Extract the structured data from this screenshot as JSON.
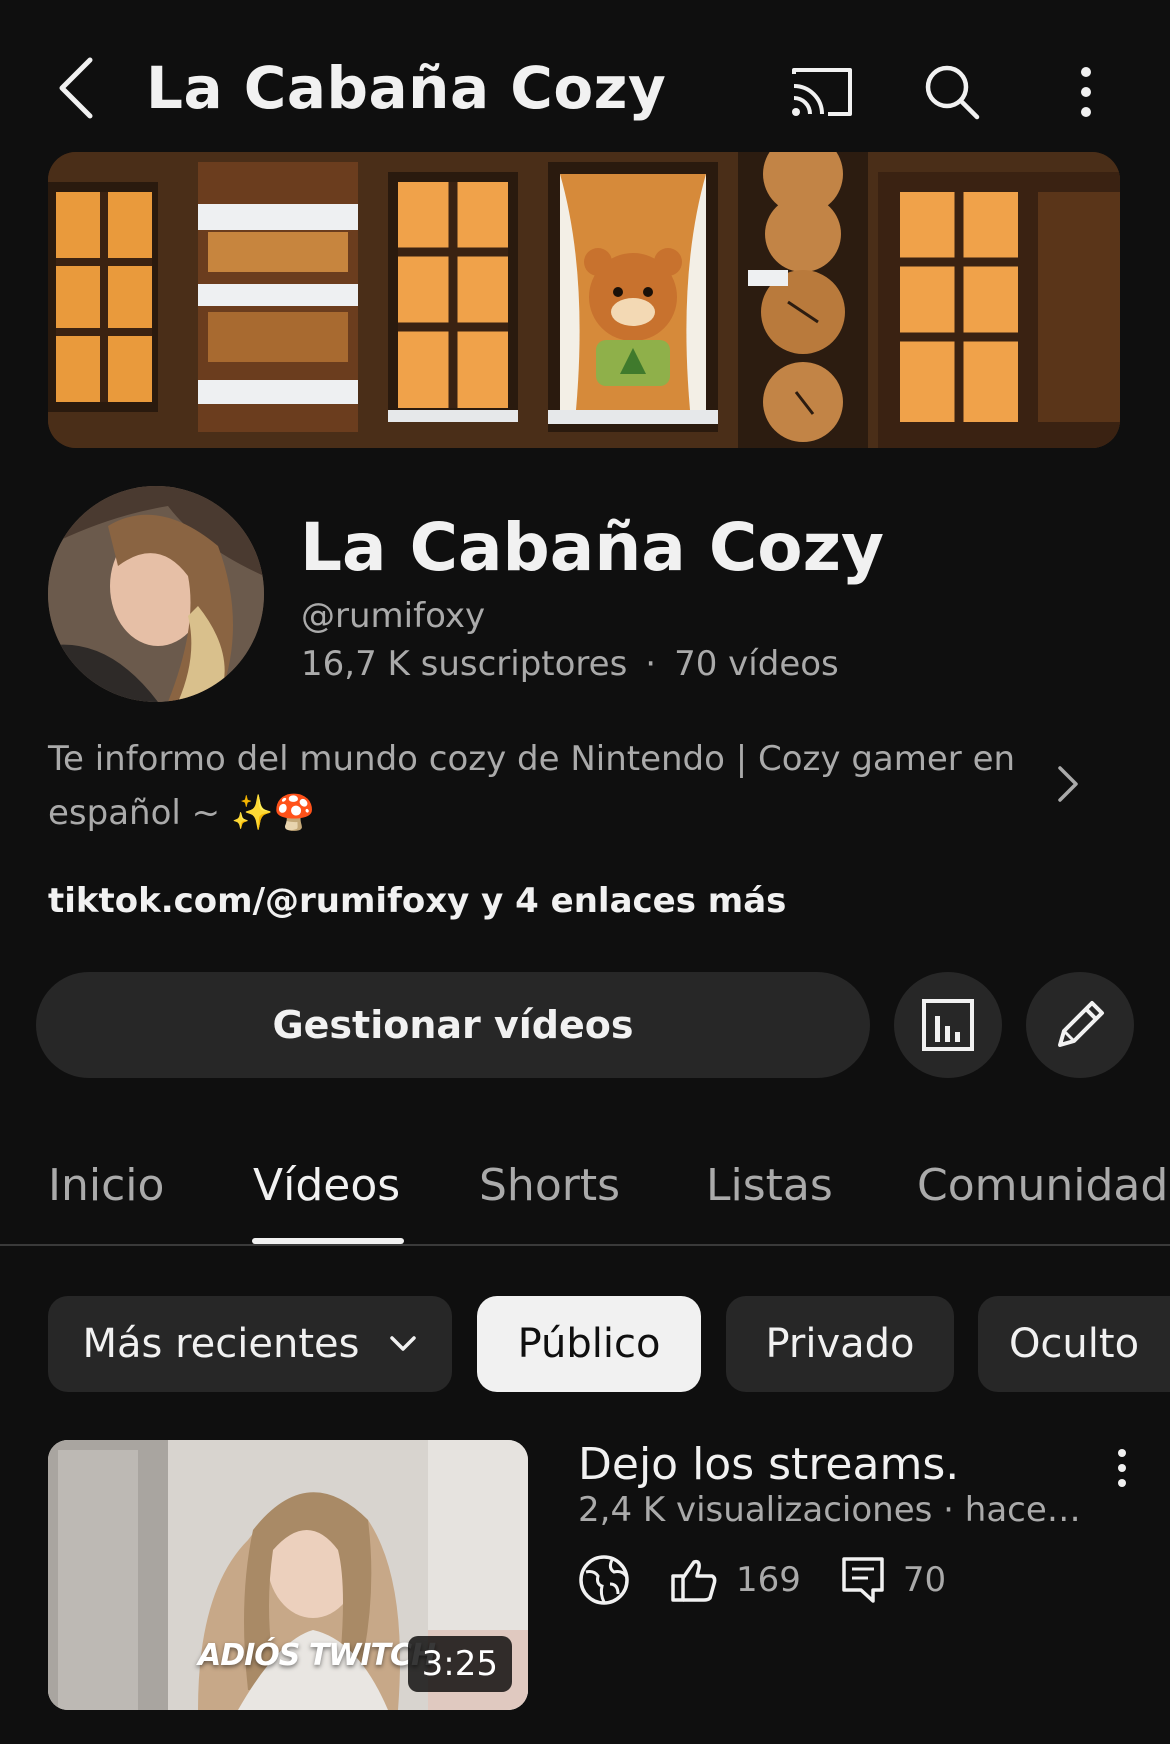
{
  "header": {
    "title": "La Cabaña Cozy",
    "icons": [
      "back-arrow-icon",
      "cast-icon",
      "search-icon",
      "more-vertical-icon"
    ]
  },
  "channel": {
    "name": "La Cabaña Cozy",
    "handle": "@rumifoxy",
    "subscribers": "16,7 K suscriptores",
    "separator": "·",
    "videos_count": "70 vídeos",
    "description_line1": "Te informo del mundo cozy de Nintendo | Cozy gamer en",
    "description_line2": "español ~  ✨🍄",
    "links": "tiktok.com/@rumifoxy y 4 enlaces más"
  },
  "actions": {
    "manage_label": "Gestionar vídeos",
    "analytics_icon": "analytics-icon",
    "edit_icon": "pencil-icon"
  },
  "tabs": [
    {
      "label": "Inicio",
      "active": false
    },
    {
      "label": "Vídeos",
      "active": true
    },
    {
      "label": "Shorts",
      "active": false
    },
    {
      "label": "Listas",
      "active": false
    },
    {
      "label": "Comunidad",
      "active": false
    }
  ],
  "filters": {
    "sort_label": "Más recientes",
    "chips": [
      {
        "label": "Público",
        "selected": true
      },
      {
        "label": "Privado",
        "selected": false
      },
      {
        "label": "Oculto",
        "selected": false
      }
    ]
  },
  "videos": [
    {
      "title": "Dejo los streams.",
      "meta": "2,4 K visualizaciones · hace…",
      "thumbnail_caption": "ADIÓS TWITCH",
      "duration": "3:25",
      "likes": "169",
      "comments": "70",
      "visibility_icon": "globe-icon"
    }
  ],
  "colors": {
    "background": "#0f0f0f",
    "surface": "#272727",
    "text_primary": "#f1f1f1",
    "text_secondary": "#aaaaaa",
    "chip_selected": "#f1f1f1"
  }
}
